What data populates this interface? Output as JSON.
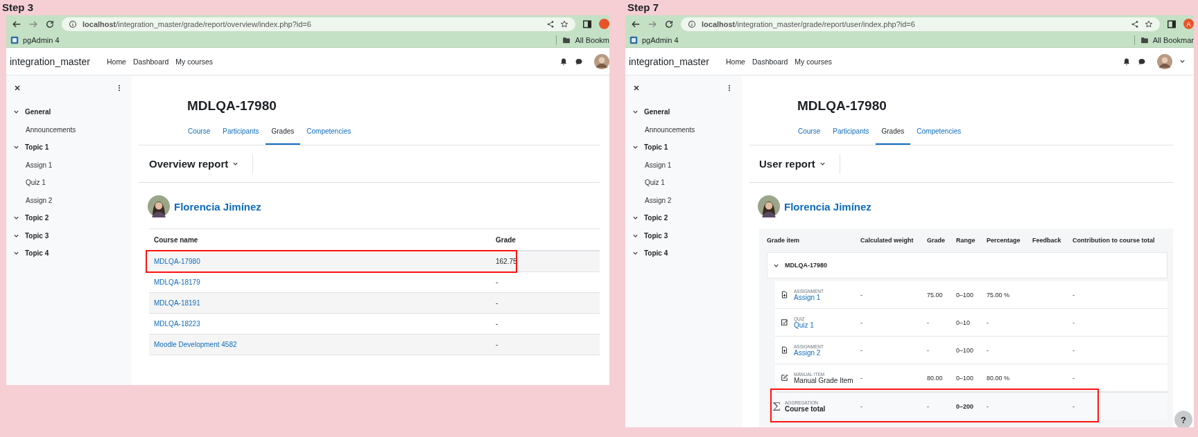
{
  "panels": [
    {
      "kind": "overview",
      "step_label": "Step 3",
      "browser": {
        "url": "**localhost**/integration_master/grade/report/overview/index.php?id=6",
        "bookmark": "pgAdmin 4",
        "all_bookmarks": "All Bookm"
      },
      "site": {
        "name": "integration_master",
        "nav": [
          "Home",
          "Dashboard",
          "My courses"
        ]
      },
      "course_index": [
        {
          "label": "General",
          "children": [
            "Announcements"
          ]
        },
        {
          "label": "Topic 1",
          "children": [
            "Assign 1",
            "Quiz 1",
            "Assign 2"
          ]
        },
        {
          "label": "Topic 2"
        },
        {
          "label": "Topic 3"
        },
        {
          "label": "Topic 4"
        }
      ],
      "course_title": "MDLQA-17980",
      "tabs": [
        {
          "label": "Course",
          "selected": false
        },
        {
          "label": "Participants",
          "selected": false
        },
        {
          "label": "Grades",
          "selected": true
        },
        {
          "label": "Competencies",
          "selected": false
        }
      ],
      "report_selector": "Overview report",
      "user_name": "Florencia Jimínez",
      "table": {
        "columns": [
          "Course name",
          "Grade"
        ],
        "rows": [
          {
            "course": "MDLQA-17980",
            "grade": "162.75",
            "highlighted": true
          },
          {
            "course": "MDLQA-18179",
            "grade": "-",
            "highlighted": false
          },
          {
            "course": "MDLQA-18191",
            "grade": "-",
            "highlighted": false
          },
          {
            "course": "MDLQA-18223",
            "grade": "-",
            "highlighted": false
          },
          {
            "course": "Moodle Development 4582",
            "grade": "-",
            "highlighted": false
          }
        ]
      }
    },
    {
      "kind": "user",
      "step_label": "Step 7",
      "browser": {
        "url": "**localhost**/integration_master/grade/report/user/index.php?id=6",
        "bookmark": "pgAdmin 4",
        "all_bookmarks": "All Bookmar",
        "profile_initial": "A"
      },
      "site": {
        "name": "integration_master",
        "nav": [
          "Home",
          "Dashboard",
          "My courses"
        ],
        "account_menu": true
      },
      "course_index": [
        {
          "label": "General",
          "children": [
            "Announcements"
          ]
        },
        {
          "label": "Topic 1",
          "children": [
            "Assign 1",
            "Quiz 1",
            "Assign 2"
          ]
        },
        {
          "label": "Topic 2"
        },
        {
          "label": "Topic 3"
        },
        {
          "label": "Topic 4"
        }
      ],
      "course_title": "MDLQA-17980",
      "tabs": [
        {
          "label": "Course",
          "selected": false
        },
        {
          "label": "Participants",
          "selected": false
        },
        {
          "label": "Grades",
          "selected": true
        },
        {
          "label": "Competencies",
          "selected": false
        }
      ],
      "report_selector": "User report",
      "user_name": "Florencia Jimínez",
      "table": {
        "columns": [
          "Grade item",
          "Calculated weight",
          "Grade",
          "Range",
          "Percentage",
          "Feedback",
          "Contribution to course total"
        ],
        "category": "MDLQA-17980",
        "items": [
          {
            "kind": "assignment",
            "type": "ASSIGNMENT",
            "name": "Assign 1",
            "weight": "-",
            "grade": "75.00",
            "range": "0–100",
            "percentage": "75.00 %",
            "contribution": "-",
            "highlighted": false
          },
          {
            "kind": "quiz",
            "type": "QUIZ",
            "name": "Quiz 1",
            "weight": "-",
            "grade": "-",
            "range": "0–10",
            "percentage": "-",
            "contribution": "-",
            "highlighted": false
          },
          {
            "kind": "assignment",
            "type": "ASSIGNMENT",
            "name": "Assign 2",
            "weight": "-",
            "grade": "-",
            "range": "0–100",
            "percentage": "-",
            "contribution": "-",
            "highlighted": false
          },
          {
            "kind": "manual",
            "type": "MANUAL ITEM",
            "name": "Manual Grade Item",
            "weight": "-",
            "grade": "80.00",
            "range": "0–100",
            "percentage": "80.00 %",
            "contribution": "-",
            "highlighted": false
          },
          {
            "kind": "aggregation",
            "symbol": "Σ",
            "type": "AGGREGATION",
            "name": "Course total",
            "weight": "-",
            "grade": "-",
            "range": "0–200",
            "percentage": "-",
            "contribution": "-",
            "highlighted": true
          }
        ]
      },
      "help_button": "?"
    }
  ]
}
